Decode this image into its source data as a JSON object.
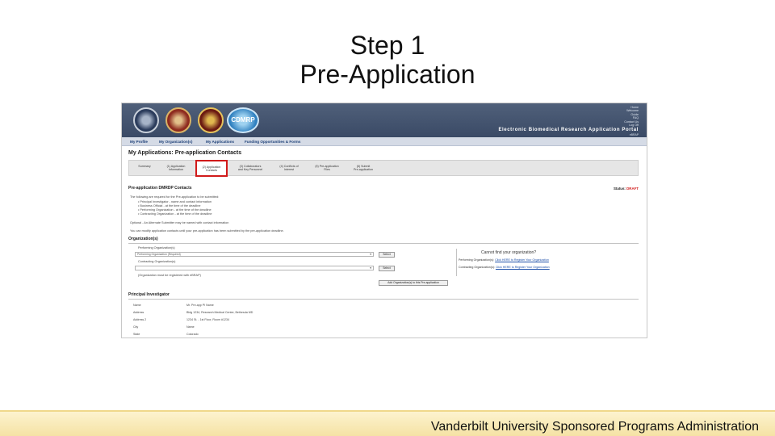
{
  "slide": {
    "title_line1": "Step 1",
    "title_line2": "Pre-Application",
    "footer": "Vanderbilt University Sponsored Programs Administration"
  },
  "portal": {
    "logo_text": "CDMRP",
    "top_links": [
      "Home",
      "Welcome",
      "Guide",
      "FAQ",
      "Contact Us",
      "Log Off"
    ],
    "title": "Electronic Biomedical Research Application Portal",
    "subtitle": "eBRAP"
  },
  "menu": [
    "My Profile",
    "My Organization(s)",
    "My Applications",
    "Funding Opportunities & Forms"
  ],
  "page_heading": "My Applications: Pre-application Contacts",
  "steps": [
    {
      "label_line1": "Summary",
      "label_line2": "",
      "active": false
    },
    {
      "label_line1": "(1) Application",
      "label_line2": "Information",
      "active": false
    },
    {
      "label_line1": "(2) Application",
      "label_line2": "Contacts",
      "active": true
    },
    {
      "label_line1": "(3) Collaborators",
      "label_line2": "and Key Personnel",
      "active": false
    },
    {
      "label_line1": "(4) Conflicts of",
      "label_line2": "Interest",
      "active": false
    },
    {
      "label_line1": "(5) Pre-application",
      "label_line2": "Files",
      "active": false
    },
    {
      "label_line1": "(6) Submit",
      "label_line2": "Pre-application",
      "active": false
    }
  ],
  "contacts_section": {
    "heading": "Pre-application DMRDP Contacts",
    "status_label": "Status:",
    "status_value": "DRAFT",
    "intro": "The following are required for the Pre-application to be submitted:",
    "bullets": [
      "Principal Investigator - name and contact information",
      "Business Official - at the time of the deadline",
      "Performing Organization - at the time of the deadline",
      "Contracting Organization - at the time of the deadline"
    ],
    "optional": "Optional - An Alternate Submitter may be named with contact information",
    "note": "You can modify application contacts until your pre-application has been submitted by the pre-application deadline."
  },
  "organizations": {
    "heading": "Organization(s)",
    "performing_label": "Performing Organization(s)",
    "performing_value": "Performing Organization (Required)",
    "contracting_label": "Contracting Organization(s)",
    "select_button": "Select",
    "hint": "(Organization must be registered with eBRAP)",
    "add_button": "Add Organization(s) to this Pre-application"
  },
  "find_org": {
    "title": "Cannot find your organization?",
    "performing_text": "Performing Organization(s):",
    "performing_link": "Click HERE to Register Your Organization",
    "contracting_text": "Contracting Organization(s):",
    "contracting_link": "Click HERE to Register Your Organization"
  },
  "principal_investigator": {
    "heading": "Principal Investigator",
    "rows": [
      {
        "label": "Name",
        "value": "Mr. Pre-app PI Name"
      },
      {
        "label": "Address",
        "value": "Bldg 1234, Research Medical Center, Bethesda MD"
      },
      {
        "label": "Address 2",
        "value": "1234 St. - 1st Floor, Room #1234"
      },
      {
        "label": "City",
        "value": "Name"
      },
      {
        "label": "State",
        "value": "Colorado"
      }
    ]
  }
}
